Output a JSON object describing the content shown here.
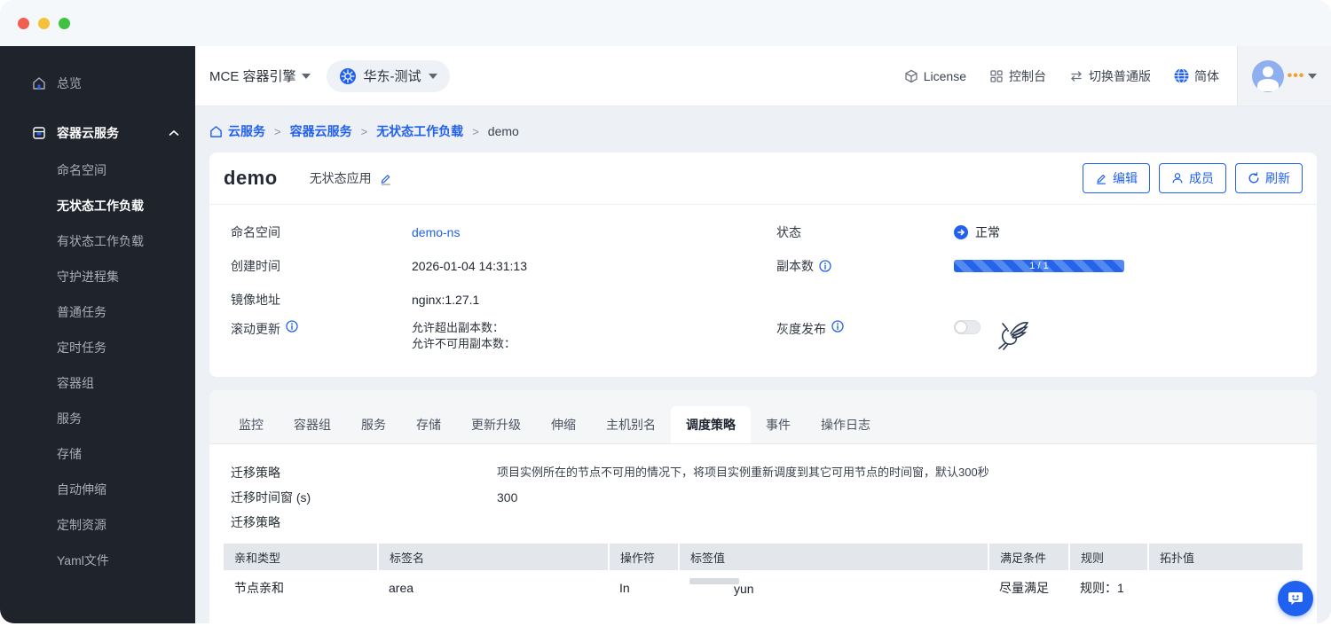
{
  "titlebar": {
    "note": "macos-window-controls"
  },
  "sidebar": {
    "overview": {
      "label": "总览"
    },
    "group": {
      "label": "容器云服务"
    },
    "children": [
      {
        "label": "命名空间"
      },
      {
        "label": "无状态工作负载"
      },
      {
        "label": "有状态工作负载"
      },
      {
        "label": "守护进程集"
      },
      {
        "label": "普通任务"
      },
      {
        "label": "定时任务"
      },
      {
        "label": "容器组"
      },
      {
        "label": "服务"
      },
      {
        "label": "存储"
      },
      {
        "label": "自动伸缩"
      },
      {
        "label": "定制资源"
      },
      {
        "label": "Yaml文件"
      }
    ],
    "active_child": "无状态工作负载"
  },
  "topnav": {
    "product": "MCE 容器引擎",
    "cluster": "华东-测试",
    "license": "License",
    "console": "控制台",
    "switch_edition": "切换普通版",
    "language": "简体"
  },
  "breadcrumb": {
    "items": [
      {
        "label": "云服务"
      },
      {
        "label": "容器云服务"
      },
      {
        "label": "无状态工作负载"
      },
      {
        "label": "demo"
      }
    ]
  },
  "workload": {
    "name": "demo",
    "type": "无状态应用",
    "edit_btn": "编辑",
    "member_btn": "成员",
    "refresh_btn": "刷新",
    "namespace_label": "命名空间",
    "namespace": "demo-ns",
    "created_label": "创建时间",
    "created": "2026-01-04 14:31:13",
    "image_label": "镜像地址",
    "image": "nginx:1.27.1",
    "rolling_label": "滚动更新",
    "rolling_line1": "允许超出副本数：",
    "rolling_line2": "允许不可用副本数：",
    "status_label": "状态",
    "status": "正常",
    "replicas_label": "副本数",
    "replicas": "1 / 1",
    "gray_label": "灰度发布"
  },
  "tabs": {
    "items": [
      {
        "label": "监控"
      },
      {
        "label": "容器组"
      },
      {
        "label": "服务"
      },
      {
        "label": "存储"
      },
      {
        "label": "更新升级"
      },
      {
        "label": "伸缩"
      },
      {
        "label": "主机别名"
      },
      {
        "label": "调度策略"
      },
      {
        "label": "事件"
      },
      {
        "label": "操作日志"
      }
    ],
    "active": "调度策略"
  },
  "scheduling": {
    "migration_label": "迁移策略",
    "migration_desc": "项目实例所在的节点不可用的情况下，将项目实例重新调度到其它可用节点的时间窗，默认300秒",
    "window_label": "迁移时间窗 (s)",
    "window_value": "300",
    "section_label": "迁移策略",
    "table": {
      "headers": [
        {
          "label": "亲和类型"
        },
        {
          "label": "标签名"
        },
        {
          "label": "操作符"
        },
        {
          "label": "标签值"
        },
        {
          "label": "满足条件"
        },
        {
          "label": "规则"
        },
        {
          "label": "拓扑值"
        }
      ],
      "row": {
        "affinity_type": "节点亲和",
        "label_key": "area",
        "operator": "In",
        "label_value": "yun",
        "condition": "尽量满足",
        "rule": "规则：1",
        "topology": ""
      }
    }
  },
  "colors": {
    "accent": "#2161f0",
    "sidebar_bg": "#1f232c",
    "page_bg": "#edf0f5",
    "titlebar_bg": "#f5f8fa",
    "table_header_bg": "#e3e6ea"
  }
}
